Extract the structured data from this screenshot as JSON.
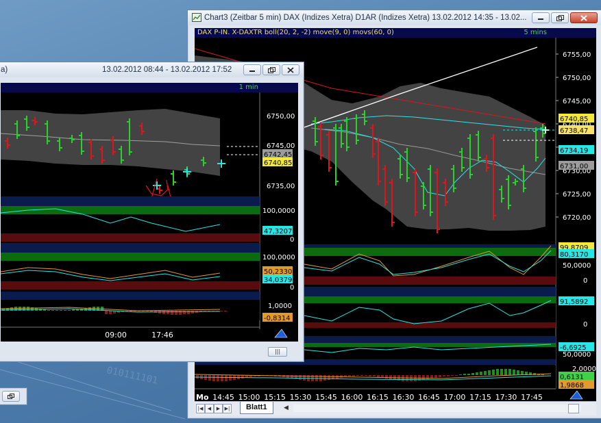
{
  "colors": {
    "price_green": "#29d12c",
    "price_red": "#e0151c",
    "cyan": "#27e6e6",
    "band_fill": "#4a4a4a",
    "legend_bg": "#07094d",
    "zone_green": "#0b6b10",
    "zone_red": "#5a0b0d",
    "zone_blue": "#0a1c4d",
    "orange": "#e39a2d",
    "yellow_tag": "#f4e83b"
  },
  "icons": {
    "window_icon": "chart-window-icon",
    "arrow": "blue-arrow-icon"
  },
  "chart3": {
    "title": "Chart3 (Zeitbar 5 min)  DAX (Indizes Xetra) D1AR (Indizes Xetra) 13.02.2012 14:35 - 13.02...",
    "legend": "DAX P-IN. X-DAXTR boll(20, 2, -2) move(9, 0) movs(60, 0)",
    "timeframe": "5 mins",
    "price_ticks": [
      "6755,00",
      "6750,00",
      "6745,00",
      "6740,00",
      "6735,00",
      "6730,00",
      "6725,00",
      "6720,00"
    ],
    "price_tags": [
      "6740,85",
      "6738,47",
      "6734,19",
      "6731,00"
    ],
    "ind1_ticks": [
      "50,0000",
      "0"
    ],
    "ind1_tags": [
      "99,8709",
      "80,3170"
    ],
    "ind2_ticks": [
      "0"
    ],
    "ind2_tag": "91,5892",
    "ind3_ticks": [
      "50,0000"
    ],
    "ind3_tag": "-6,6925",
    "ind4_ticks": [
      "2,0000"
    ],
    "ind4_tags": [
      "0,6131",
      "1,9868"
    ],
    "day_label": "Mo",
    "time_labels": [
      "14:45",
      "15:00",
      "15:15",
      "15:30",
      "15:45",
      "16:00",
      "16:15",
      "16:30",
      "16:45",
      "17:00",
      "17:15",
      "17:30",
      "17:45"
    ],
    "sheet_tab": "Blatt1"
  },
  "chart_1min": {
    "title": "13.02.2012 08:44 - 13.02.2012 17:52",
    "title_left_fragment": "a)",
    "timeframe": "1 min",
    "price_ticks": [
      "6750,00",
      "6745,00",
      "6735,00"
    ],
    "price_tags": [
      "6742,45",
      "6740,85"
    ],
    "ind1_ticks": [
      "100,0000",
      "0"
    ],
    "ind1_tag": "47,3207",
    "ind2_ticks": [
      "100,0000",
      "0"
    ],
    "ind2_tags": [
      "50,2330",
      "34,0379"
    ],
    "ind3_ticks": [
      "1,0000"
    ],
    "ind3_tag": "-0,8314",
    "time_labels": [
      "09:00",
      "17:46"
    ]
  },
  "background_text": "010111101"
}
